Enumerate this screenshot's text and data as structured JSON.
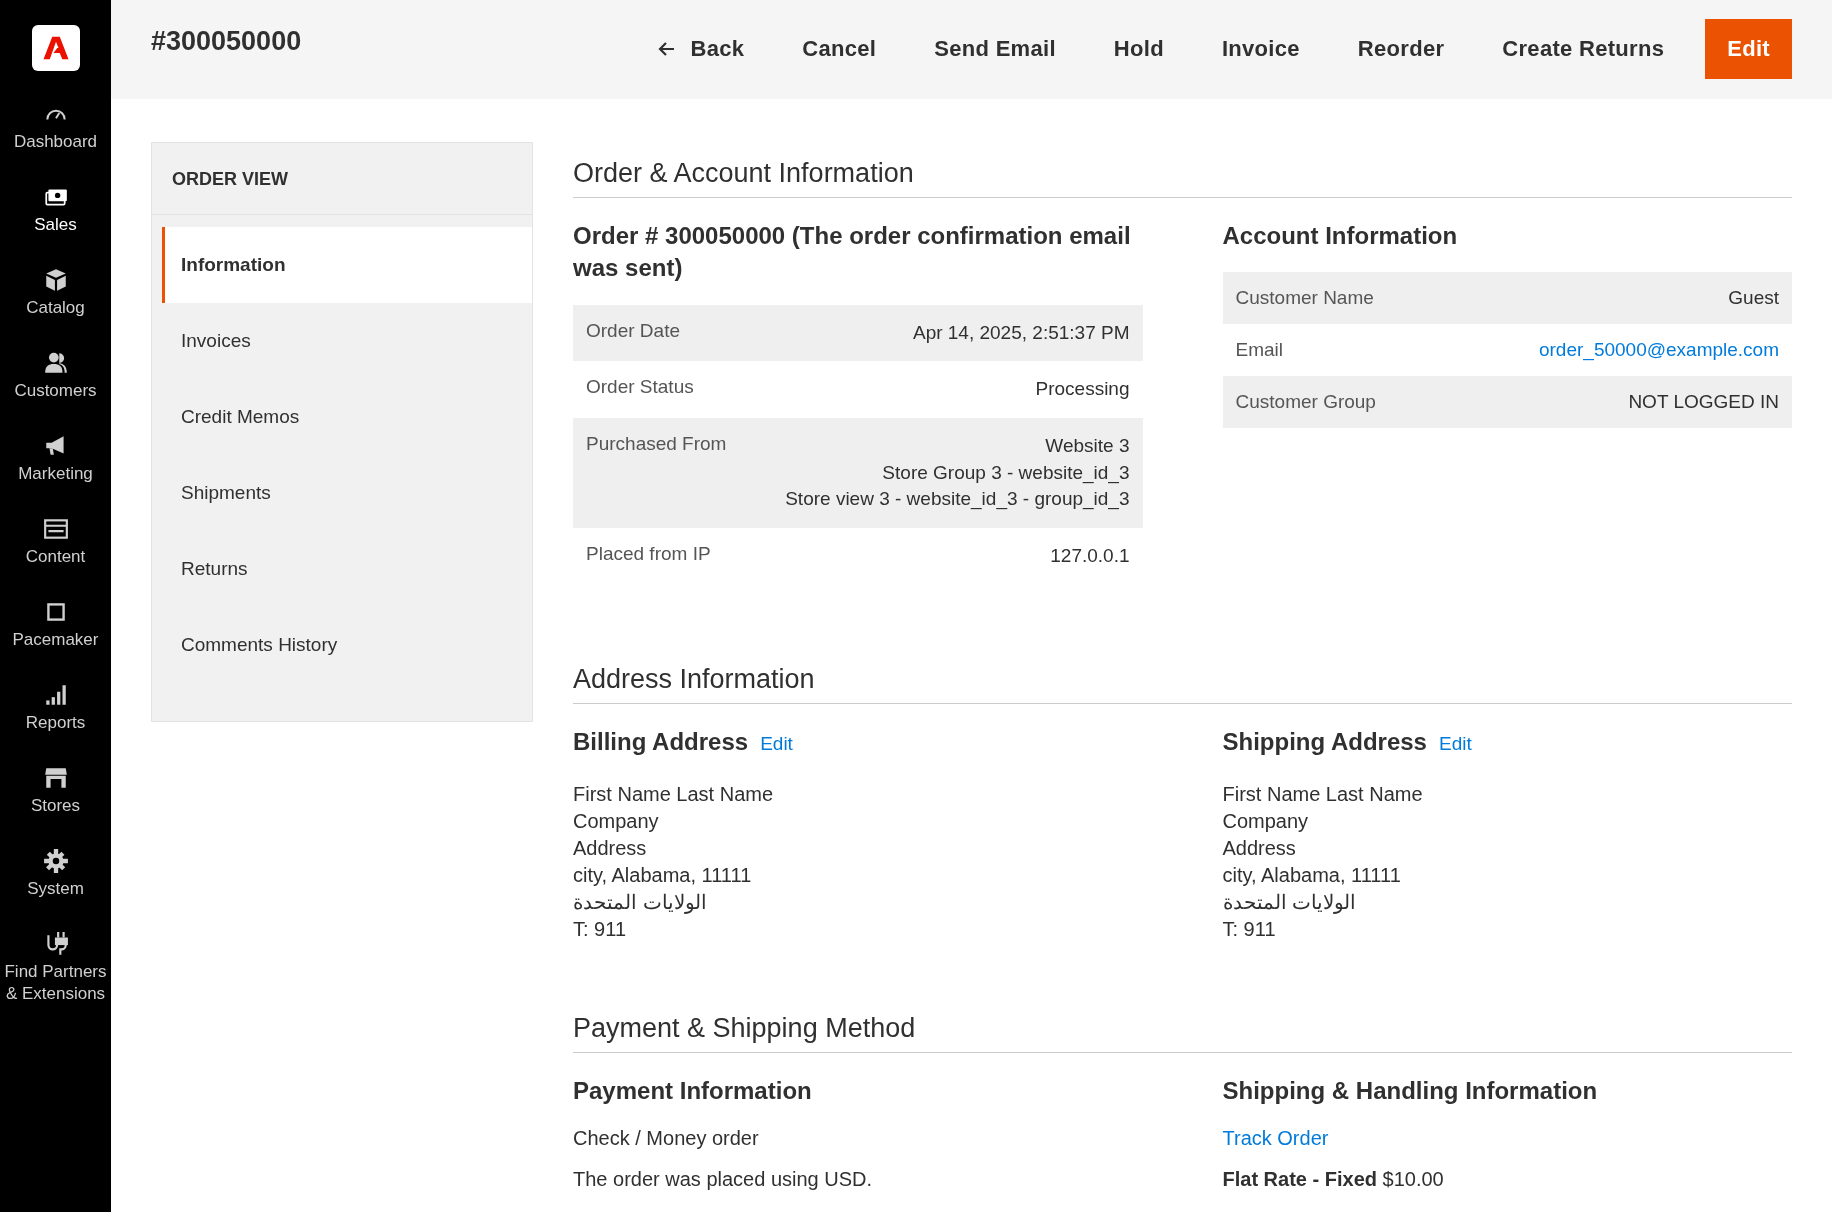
{
  "nav": [
    {
      "label": "Dashboard",
      "selected": false
    },
    {
      "label": "Sales",
      "selected": true
    },
    {
      "label": "Catalog",
      "selected": false
    },
    {
      "label": "Customers",
      "selected": false
    },
    {
      "label": "Marketing",
      "selected": false
    },
    {
      "label": "Content",
      "selected": false
    },
    {
      "label": "Pacemaker",
      "selected": false
    },
    {
      "label": "Reports",
      "selected": false
    },
    {
      "label": "Stores",
      "selected": false
    },
    {
      "label": "System",
      "selected": false
    },
    {
      "label": "Find Partners & Extensions",
      "selected": false
    }
  ],
  "page_title": "#300050000",
  "actions": [
    {
      "label": "Back",
      "kind": "back"
    },
    {
      "label": "Cancel",
      "kind": "plain"
    },
    {
      "label": "Send Email",
      "kind": "plain"
    },
    {
      "label": "Hold",
      "kind": "plain"
    },
    {
      "label": "Invoice",
      "kind": "plain"
    },
    {
      "label": "Reorder",
      "kind": "plain"
    },
    {
      "label": "Create Returns",
      "kind": "plain"
    },
    {
      "label": "Edit",
      "kind": "primary"
    }
  ],
  "order_view": {
    "title": "ORDER VIEW",
    "tabs": [
      {
        "label": "Information",
        "selected": true
      },
      {
        "label": "Invoices",
        "selected": false
      },
      {
        "label": "Credit Memos",
        "selected": false
      },
      {
        "label": "Shipments",
        "selected": false
      },
      {
        "label": "Returns",
        "selected": false
      },
      {
        "label": "Comments History",
        "selected": false
      }
    ]
  },
  "order_account": {
    "title": "Order & Account Information",
    "order_heading": "Order # 300050000 (The order confirmation email was sent)",
    "order_rows": [
      {
        "label": "Order Date",
        "value": [
          "Apr 14, 2025, 2:51:37 PM"
        ]
      },
      {
        "label": "Order Status",
        "value": [
          "Processing"
        ]
      },
      {
        "label": "Purchased From",
        "value": [
          "Website 3",
          "Store Group 3 - website_id_3",
          "Store view 3 - website_id_3 - group_id_3"
        ]
      },
      {
        "label": "Placed from IP",
        "value": [
          "127.0.0.1"
        ]
      }
    ],
    "account_heading": "Account Information",
    "account_rows": [
      {
        "label": "Customer Name",
        "value": "Guest",
        "kind": "text"
      },
      {
        "label": "Email",
        "value": "order_50000@example.com",
        "kind": "link"
      },
      {
        "label": "Customer Group",
        "value": "NOT LOGGED IN",
        "kind": "text"
      }
    ]
  },
  "address": {
    "title": "Address Information",
    "blocks": [
      {
        "heading": "Billing Address",
        "edit": "Edit",
        "lines": [
          "First Name Last Name",
          "Company",
          "Address",
          "city, Alabama, 11111",
          "الولايات المتحدة",
          "T: 911"
        ]
      },
      {
        "heading": "Shipping Address",
        "edit": "Edit",
        "lines": [
          "First Name Last Name",
          "Company",
          "Address",
          "city, Alabama, 11111",
          "الولايات المتحدة",
          "T: 911"
        ]
      }
    ]
  },
  "payment_shipping": {
    "title": "Payment & Shipping Method",
    "payment": {
      "heading": "Payment Information",
      "method": "Check / Money order",
      "note": "The order was placed using USD."
    },
    "shipping": {
      "heading": "Shipping & Handling Information",
      "track": "Track Order",
      "rate": "**Flat Rate - Fixed** $10.00"
    }
  }
}
